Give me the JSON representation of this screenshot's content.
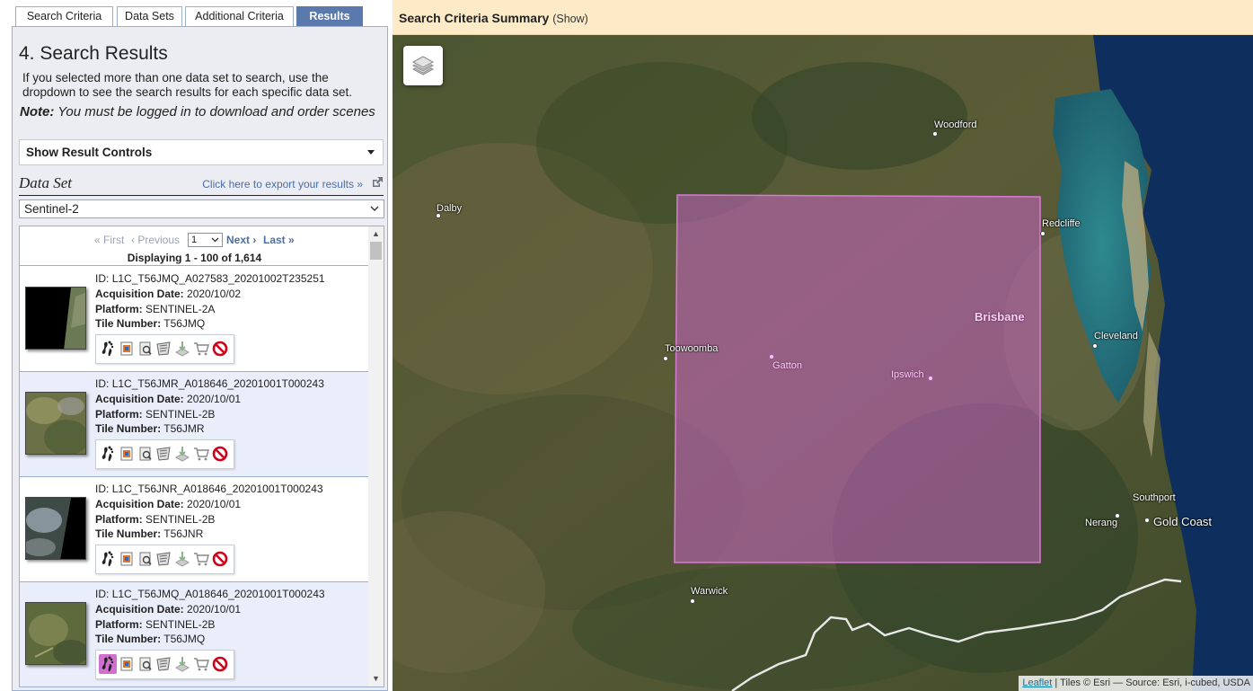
{
  "tabs": [
    {
      "label": "Search Criteria",
      "active": false
    },
    {
      "label": "Data Sets",
      "active": false
    },
    {
      "label": "Additional Criteria",
      "active": false
    },
    {
      "label": "Results",
      "active": true
    }
  ],
  "panel": {
    "title": "4. Search Results",
    "intro": "If you selected more than one data set to search, use the dropdown to see the search results for each specific data set.",
    "note_label": "Note:",
    "note_text": "You must be logged in to download and order scenes",
    "controls_toggle": "Show Result Controls",
    "dataset_label": "Data Set",
    "export_link": "Click here to export your results »",
    "dataset_selected": "Sentinel-2"
  },
  "pager": {
    "first": "« First",
    "previous": "‹ Previous",
    "page": "1",
    "next": "Next ›",
    "last": "Last »",
    "displaying": "Displaying 1 - 100 of 1,614"
  },
  "labels": {
    "id": "ID:",
    "acq": "Acquisition Date:",
    "platform": "Platform:",
    "tile": "Tile Number:"
  },
  "results": [
    {
      "id": "L1C_T56JMQ_A027583_20201002T235251",
      "acq_date": "2020/10/02",
      "platform": "SENTINEL-2A",
      "tile": "T56JMQ",
      "thumb": "dark-edge"
    },
    {
      "id": "L1C_T56JMR_A018646_20201001T000243",
      "acq_date": "2020/10/01",
      "platform": "SENTINEL-2B",
      "tile": "T56JMR",
      "thumb": "green"
    },
    {
      "id": "L1C_T56JNR_A018646_20201001T000243",
      "acq_date": "2020/10/01",
      "platform": "SENTINEL-2B",
      "tile": "T56JNR",
      "thumb": "cloud-edge"
    },
    {
      "id": "L1C_T56JMQ_A018646_20201001T000243",
      "acq_date": "2020/10/01",
      "platform": "SENTINEL-2B",
      "tile": "T56JMQ",
      "thumb": "green2"
    }
  ],
  "tool_icons": [
    "footprint-icon",
    "overlay-icon",
    "metadata-icon",
    "compare-icon",
    "download-icon",
    "cart-icon",
    "exclude-icon"
  ],
  "map": {
    "summary_title": "Search Criteria Summary",
    "summary_show": "(Show)",
    "attribution_link": "Leaflet",
    "attribution_text": "| Tiles © Esri — Source: Esri, i-cubed, USDA",
    "places": {
      "woodford": "Woodford",
      "dalby": "Dalby",
      "redcliffe": "Redcliffe",
      "brisbane": "Brisbane",
      "toowoomba": "Toowoomba",
      "gatton": "Gatton",
      "ipswich": "Ipswich",
      "cleveland": "Cleveland",
      "southport": "Southport",
      "nerang": "Nerang",
      "goldcoast": "Gold Coast",
      "warwick": "Warwick"
    },
    "colors": {
      "aoi_fill": "#c964c4",
      "highlight": "#d16fd1",
      "accent": "#5a79ad",
      "sea": "#0d2f5c"
    }
  }
}
